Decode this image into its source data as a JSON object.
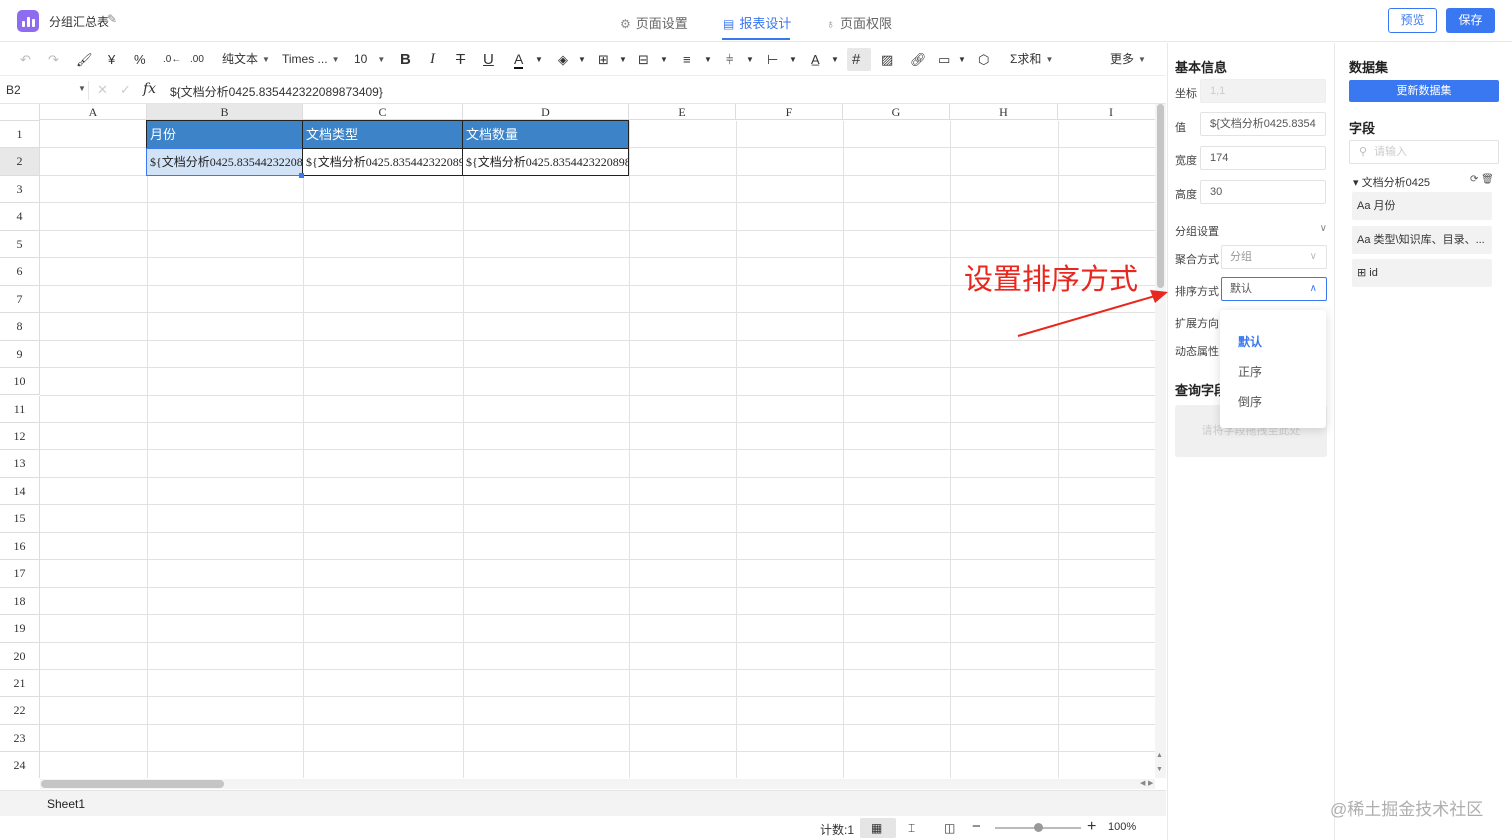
{
  "app": {
    "doc_title": "分组汇总表",
    "nav_tabs": [
      {
        "label": "页面设置",
        "icon": "gear-icon",
        "active": false
      },
      {
        "label": "报表设计",
        "icon": "report-design-icon",
        "active": true
      },
      {
        "label": "页面权限",
        "icon": "permission-icon",
        "active": false
      }
    ],
    "preview_label": "预览",
    "save_label": "保存",
    "accent_color": "#3a78f2"
  },
  "toolbar": {
    "currency": "¥",
    "percent": "%",
    "format": "纯文本",
    "font": "Times ...",
    "font_size": "10",
    "bold": "B",
    "italic": "I",
    "strike": "T",
    "underline": "U",
    "font_color": "A",
    "sum": "求和",
    "more": "更多"
  },
  "formula": {
    "cell_ref": "B2",
    "fx": "fx",
    "value": "${文档分析0425.835442322089873409}"
  },
  "sheet": {
    "columns": [
      "A",
      "B",
      "C",
      "D",
      "E",
      "F",
      "G",
      "H",
      "I"
    ],
    "rows": [
      "1",
      "2",
      "3",
      "4",
      "5",
      "6",
      "7",
      "8",
      "9",
      "10",
      "11",
      "12",
      "13",
      "14",
      "15",
      "16",
      "17",
      "18",
      "19",
      "20",
      "21",
      "22",
      "23",
      "24"
    ],
    "header_cells": [
      "月份",
      "文档类型",
      "文档数量"
    ],
    "data_cells": [
      "${文档分析0425.83544232208",
      "${文档分析0425.835442322089",
      "${文档分析0425.8354423220898"
    ],
    "header_color": "#3d83c8",
    "tab_name": "Sheet1"
  },
  "status": {
    "count": "计数:1",
    "zoom": "100%"
  },
  "properties": {
    "title": "基本信息",
    "coord_label": "坐标",
    "coord_value": "1,1",
    "value_label": "值",
    "value_value": "${文档分析0425.8354",
    "width_label": "宽度",
    "width_value": "174",
    "height_label": "高度",
    "height_value": "30",
    "group_section": "分组设置",
    "aggregate_label": "聚合方式",
    "aggregate_value": "分组",
    "sort_label": "排序方式",
    "sort_value": "默认",
    "expand_label": "扩展方向",
    "dynamic_label": "动态属性",
    "query_title": "查询字段",
    "query_placeholder": "请将字段拖拽至此处",
    "sort_options": [
      "默认",
      "正序",
      "倒序"
    ]
  },
  "dataset": {
    "title": "数据集",
    "update_button": "更新数据集",
    "fields_title": "字段",
    "search_placeholder": "请输入",
    "tree_node": "文档分析0425",
    "fields": [
      "月份",
      "类型\\知识库、目录、...",
      "id"
    ]
  },
  "annotation": {
    "text": "设置排序方式",
    "color": "#e8281e"
  },
  "watermark": "@稀土掘金技术社区"
}
